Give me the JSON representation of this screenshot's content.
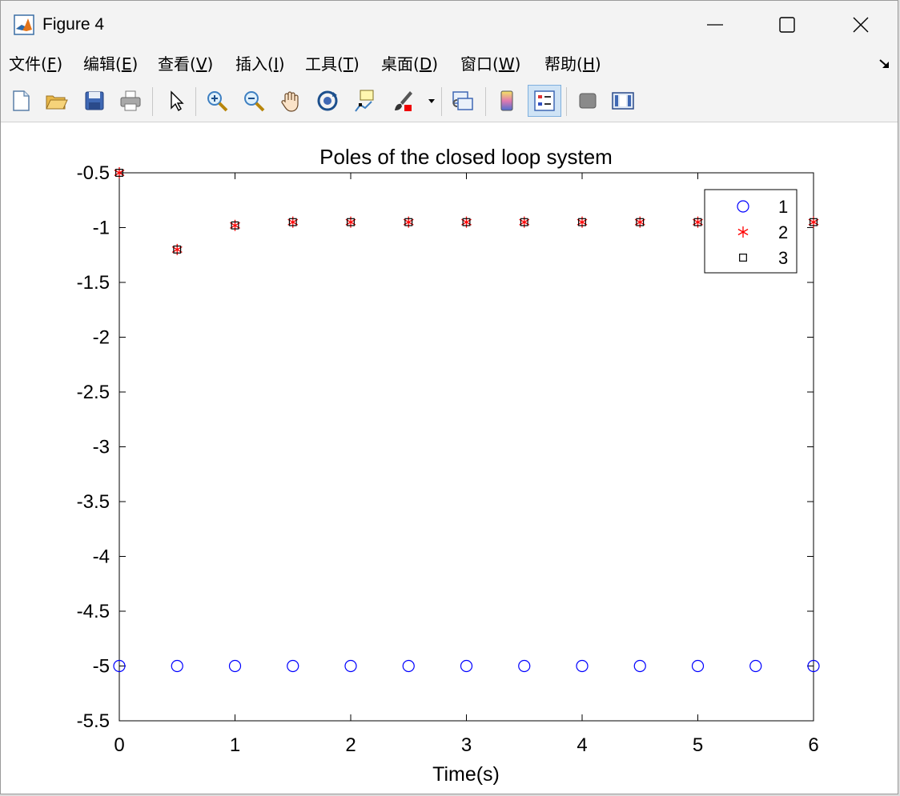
{
  "window": {
    "title": "Figure 4",
    "controls": {
      "minimize": "minimize-icon",
      "maximize": "maximize-icon",
      "close": "close-icon"
    }
  },
  "menu": [
    {
      "name": "file",
      "label": "文件(",
      "key": "F",
      "suffix": ")"
    },
    {
      "name": "edit",
      "label": "编辑(",
      "key": "E",
      "suffix": ")"
    },
    {
      "name": "view",
      "label": "查看(",
      "key": "V",
      "suffix": ")"
    },
    {
      "name": "insert",
      "label": "插入(",
      "key": "I",
      "suffix": ")"
    },
    {
      "name": "tools",
      "label": "工具(",
      "key": "T",
      "suffix": ")"
    },
    {
      "name": "desktop",
      "label": "桌面(",
      "key": "D",
      "suffix": ")"
    },
    {
      "name": "window",
      "label": "窗口(",
      "key": "W",
      "suffix": ")"
    },
    {
      "name": "help",
      "label": "帮助(",
      "key": "H",
      "suffix": ")"
    }
  ],
  "toolbar": [
    "new-figure-icon",
    "open-file-icon",
    "save-icon",
    "print-icon",
    "select-arrow-icon",
    "zoom-in-icon",
    "zoom-out-icon",
    "pan-hand-icon",
    "rotate-3d-icon",
    "data-cursor-icon",
    "brush-icon",
    "brush-dropdown-icon",
    "link-plot-icon",
    "colorbar-icon",
    "legend-icon",
    "hide-plot-tools-icon",
    "show-plot-tools-icon"
  ],
  "chart_data": {
    "type": "scatter",
    "title": "Poles of the closed loop system",
    "xlabel": "Time(s)",
    "ylabel": "",
    "xlim": [
      0,
      6
    ],
    "ylim": [
      -5.5,
      -0.5
    ],
    "xticks": [
      "0",
      "1",
      "2",
      "3",
      "4",
      "5",
      "6"
    ],
    "yticks": [
      "-0.5",
      "-1",
      "-1.5",
      "-2",
      "-2.5",
      "-3",
      "-3.5",
      "-4",
      "-4.5",
      "-5",
      "-5.5"
    ],
    "grid": false,
    "legend_position": "top-right",
    "x": [
      0,
      0.5,
      1,
      1.5,
      2,
      2.5,
      3,
      3.5,
      4,
      4.5,
      5,
      5.5,
      6
    ],
    "series": [
      {
        "name": "1",
        "marker": "circle",
        "color": "#0000ff",
        "values": [
          -5,
          -5,
          -5,
          -5,
          -5,
          -5,
          -5,
          -5,
          -5,
          -5,
          -5,
          -5,
          -5
        ]
      },
      {
        "name": "2",
        "marker": "asterisk",
        "color": "#ff0000",
        "values": [
          -0.5,
          -1.2,
          -0.98,
          -0.95,
          -0.95,
          -0.95,
          -0.95,
          -0.95,
          -0.95,
          -0.95,
          -0.95,
          -0.95,
          -0.95
        ]
      },
      {
        "name": "3",
        "marker": "square",
        "color": "#000000",
        "values": [
          -0.5,
          -1.2,
          -0.98,
          -0.95,
          -0.95,
          -0.95,
          -0.95,
          -0.95,
          -0.95,
          -0.95,
          -0.95,
          -0.95,
          -0.95
        ]
      }
    ]
  }
}
